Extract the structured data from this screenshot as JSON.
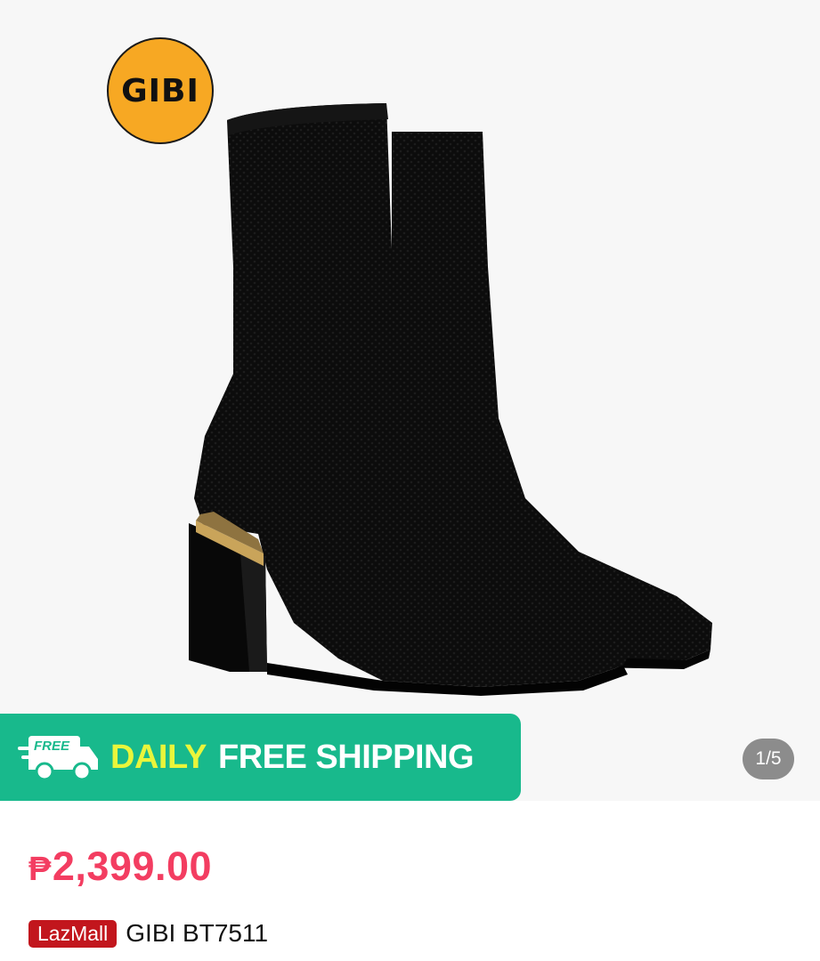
{
  "gallery": {
    "brand_logo_text": "GIBI",
    "image_counter": "1/5",
    "banner": {
      "free_tag": "FREE",
      "daily": "DAILY",
      "free_shipping": "FREE SHIPPING",
      "color": "#18b98c",
      "accent_color": "#e9f53b"
    }
  },
  "product": {
    "currency": "₱",
    "price": "2,399.00",
    "price_color": "#f33d61",
    "mall_badge": "LazMall",
    "mall_badge_color": "#c2161d",
    "name": "GIBI BT7511"
  }
}
